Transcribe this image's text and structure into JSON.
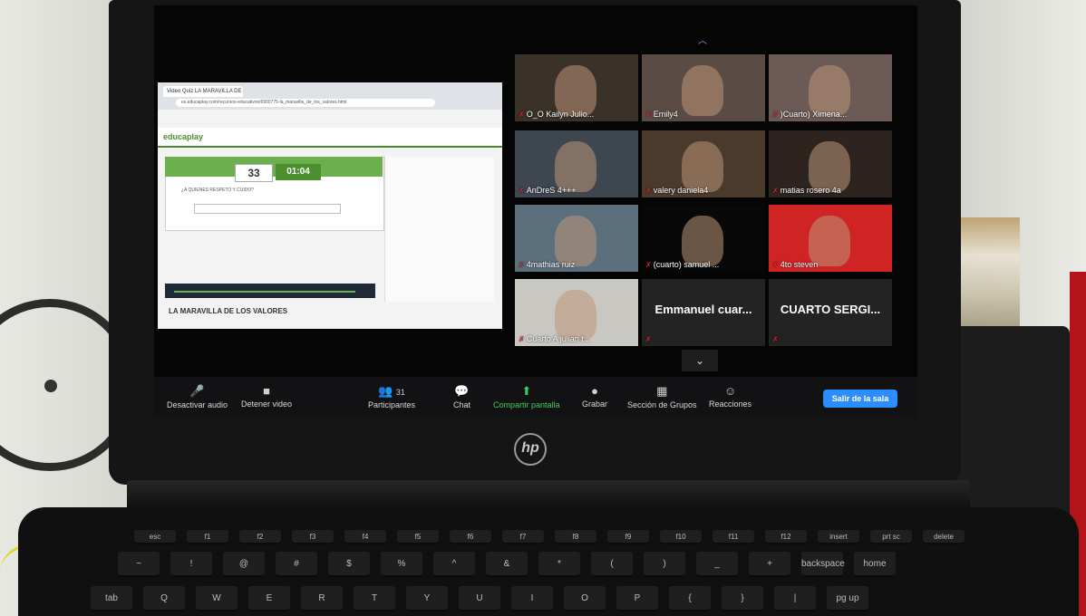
{
  "scene": {
    "laptop_brand": "hp"
  },
  "browser": {
    "tab_title": "Video Quiz LA MARAVILLA DE L...",
    "url": "es.educaplay.com/recursos-educativos/6900775-la_maravilla_de_los_valores.html",
    "site_logo": "educaplay",
    "score": "33",
    "timer": "01:04",
    "question": "¿A QUIENES RESPETO Y CUIDO?",
    "game_title": "LA MARAVILLA DE LOS VALORES"
  },
  "participants": [
    {
      "name": "O_O Kailyn Julio...",
      "bg": "#3a3128"
    },
    {
      "name": "Emily4",
      "bg": "#5a4c44"
    },
    {
      "name": ")Cuarto) Ximena...",
      "bg": "#6b5a55"
    },
    {
      "name": "AnDreS 4+++",
      "bg": "#3e4650"
    },
    {
      "name": "valery daniela4",
      "bg": "#4a3a2c"
    },
    {
      "name": "matias rosero 4a",
      "bg": "#2d2420"
    },
    {
      "name": "4mathias ruiz",
      "bg": "#5b6f7c"
    },
    {
      "name": "(cuarto) samuel ...",
      "bg": "#080808"
    },
    {
      "name": "4to steven",
      "bg": "#d02424"
    },
    {
      "name": "Cuarto A julian t...",
      "bg": "#c9c7c2"
    },
    {
      "name": "Emmanuel cuar...",
      "bg": "#232323",
      "camera_off": true
    },
    {
      "name": "CUARTO SERGI...",
      "bg": "#232323",
      "camera_off": true
    }
  ],
  "toolbar": {
    "mute": "Desactivar audio",
    "video": "Detener video",
    "participants_count": "31",
    "participants": "Participantes",
    "chat": "Chat",
    "share": "Compartir pantalla",
    "record": "Grabar",
    "breakout": "Sección de Grupos",
    "reactions": "Reacciones",
    "leave": "Salir de la sala"
  },
  "keyboard": {
    "row1": [
      "esc",
      "f1",
      "f2",
      "f3",
      "f4",
      "f5",
      "f6",
      "f7",
      "f8",
      "f9",
      "f10",
      "f11",
      "f12",
      "insert",
      "prt sc",
      "delete"
    ],
    "row2": [
      "~",
      "!",
      "@",
      "#",
      "$",
      "%",
      "^",
      "&",
      "*",
      "(",
      ")",
      "_",
      "+",
      "backspace",
      "home"
    ],
    "row3": [
      "tab",
      "Q",
      "W",
      "E",
      "R",
      "T",
      "Y",
      "U",
      "I",
      "O",
      "P",
      "{",
      "}",
      "|",
      "pg up"
    ]
  }
}
